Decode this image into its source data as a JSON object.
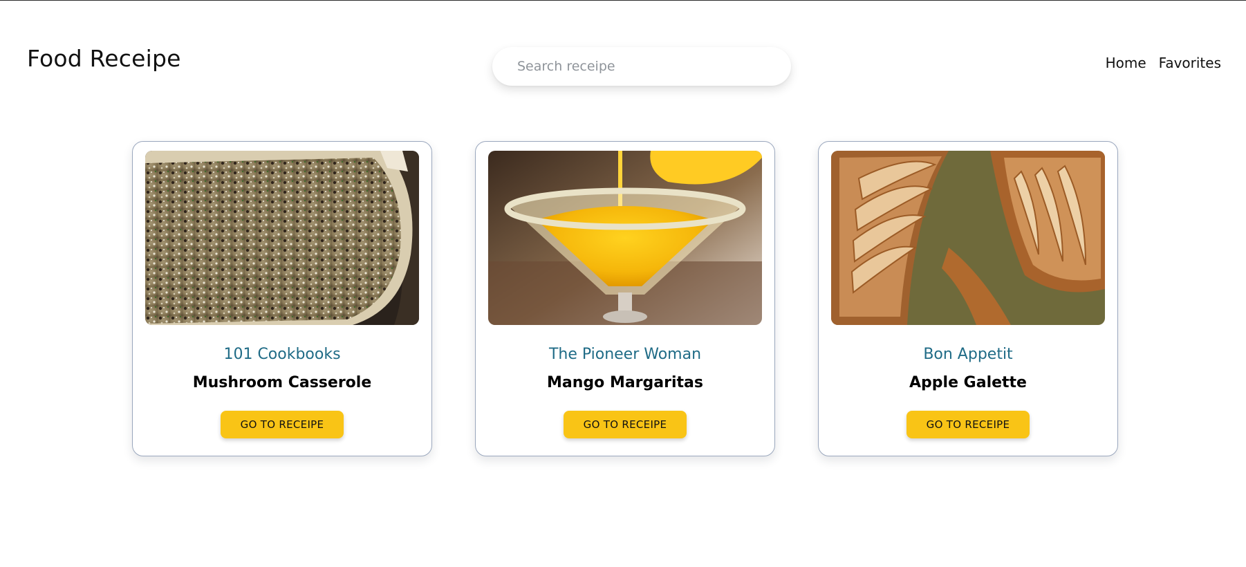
{
  "header": {
    "brand": "Food Receipe",
    "search": {
      "placeholder": "Search receipe",
      "value": ""
    },
    "nav": [
      {
        "label": "Home"
      },
      {
        "label": "Favorites"
      }
    ]
  },
  "recipes": [
    {
      "publisher": "101 Cookbooks",
      "title": "Mushroom Casserole",
      "button_label": "GO TO RECEIPE",
      "image": "casserole-photo"
    },
    {
      "publisher": "The Pioneer Woman",
      "title": "Mango Margaritas",
      "button_label": "GO TO RECEIPE",
      "image": "margarita-photo"
    },
    {
      "publisher": "Bon Appetit",
      "title": "Apple Galette",
      "button_label": "GO TO RECEIPE",
      "image": "galette-photo"
    }
  ],
  "colors": {
    "accent_button": "#f9c416",
    "publisher_text": "#1f6b86",
    "card_border": "#9aa7bd"
  }
}
